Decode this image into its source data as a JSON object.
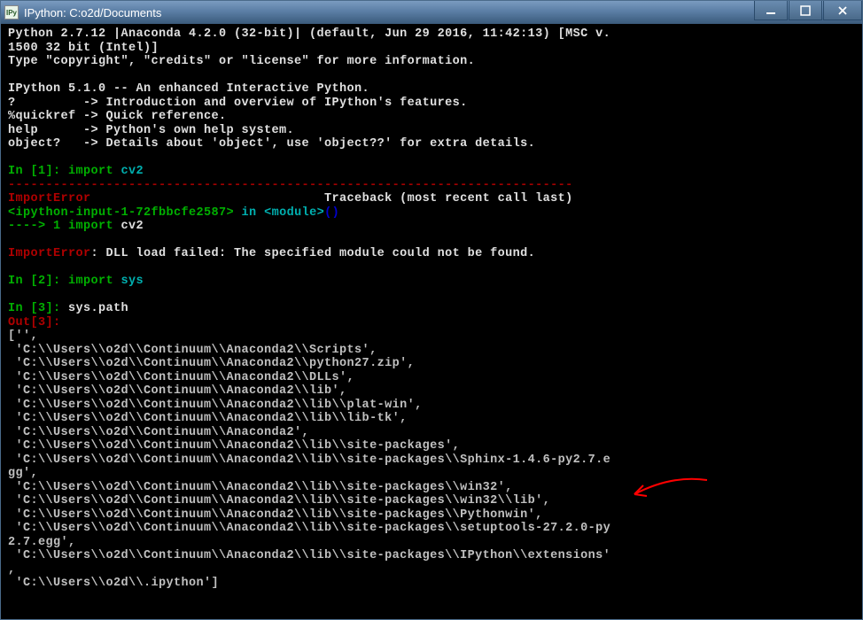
{
  "window": {
    "icon_label": "IPy",
    "title": "IPython: C:o2d/Documents"
  },
  "banner": {
    "l1": "Python 2.7.12 |Anaconda 4.2.0 (32-bit)| (default, Jun 29 2016, 11:42:13) [MSC v.",
    "l2": "1500 32 bit (Intel)]",
    "l3": "Type \"copyright\", \"credits\" or \"license\" for more information.",
    "l4": "IPython 5.1.0 -- An enhanced Interactive Python.",
    "l5": "?         -> Introduction and overview of IPython's features.",
    "l6": "%quickref -> Quick reference.",
    "l7": "help      -> Python's own help system.",
    "l8": "object?   -> Details about 'object', use 'object??' for extra details."
  },
  "session": {
    "in1_prompt": "In [1]: ",
    "in1_kw": "import ",
    "in1_mod": "cv2",
    "dashline": "---------------------------------------------------------------------------",
    "err_name": "ImportError",
    "err_tb": "                               Traceback (most recent call last)",
    "err_src_a": "<ipython-input-1-72fbbcfe2587>",
    "err_src_b": " in ",
    "err_src_c": "<module>",
    "err_src_d": "()",
    "err_arrow": "----> 1",
    "err_re_kw": " import ",
    "err_re_mod": "cv2",
    "err_msg_a": "ImportError",
    "err_msg_b": ": DLL load failed: The specified module could not be found.",
    "in2_prompt": "In [2]: ",
    "in2_kw": "import ",
    "in2_mod": "sys",
    "in3_prompt": "In [3]: ",
    "in3_code": "sys.path",
    "out3_prompt": "Out[3]: ",
    "paths": [
      "['',",
      " 'C:\\\\Users\\\\o2d\\\\Continuum\\\\Anaconda2\\\\Scripts',",
      " 'C:\\\\Users\\\\o2d\\\\Continuum\\\\Anaconda2\\\\python27.zip',",
      " 'C:\\\\Users\\\\o2d\\\\Continuum\\\\Anaconda2\\\\DLLs',",
      " 'C:\\\\Users\\\\o2d\\\\Continuum\\\\Anaconda2\\\\lib',",
      " 'C:\\\\Users\\\\o2d\\\\Continuum\\\\Anaconda2\\\\lib\\\\plat-win',",
      " 'C:\\\\Users\\\\o2d\\\\Continuum\\\\Anaconda2\\\\lib\\\\lib-tk',",
      " 'C:\\\\Users\\\\o2d\\\\Continuum\\\\Anaconda2',",
      " 'C:\\\\Users\\\\o2d\\\\Continuum\\\\Anaconda2\\\\lib\\\\site-packages',",
      " 'C:\\\\Users\\\\o2d\\\\Continuum\\\\Anaconda2\\\\lib\\\\site-packages\\\\Sphinx-1.4.6-py2.7.e"
    ],
    "paths2": [
      "gg',",
      " 'C:\\\\Users\\\\o2d\\\\Continuum\\\\Anaconda2\\\\lib\\\\site-packages\\\\win32',",
      " 'C:\\\\Users\\\\o2d\\\\Continuum\\\\Anaconda2\\\\lib\\\\site-packages\\\\win32\\\\lib',",
      " 'C:\\\\Users\\\\o2d\\\\Continuum\\\\Anaconda2\\\\lib\\\\site-packages\\\\Pythonwin',",
      " 'C:\\\\Users\\\\o2d\\\\Continuum\\\\Anaconda2\\\\lib\\\\site-packages\\\\setuptools-27.2.0-py",
      "2.7.egg',",
      " 'C:\\\\Users\\\\o2d\\\\Continuum\\\\Anaconda2\\\\lib\\\\site-packages\\\\IPython\\\\extensions'",
      ",",
      " 'C:\\\\Users\\\\o2d\\\\.ipython']"
    ]
  },
  "annotation": {
    "arrow_color": "#ff0000"
  }
}
